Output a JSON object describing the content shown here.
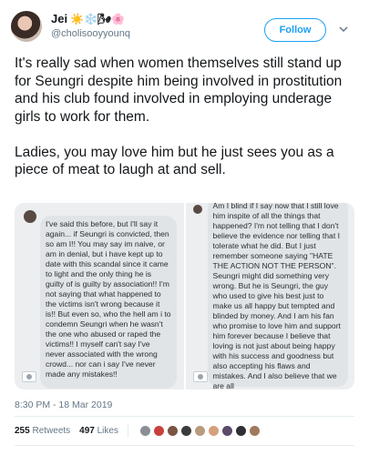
{
  "user": {
    "display_name": "Jei",
    "emoji": "☀️❄️🌬🌸",
    "handle": "@cholisooyyounq",
    "follow_label": "Follow"
  },
  "tweet": {
    "paragraphs": [
      "It's really sad when women themselves still stand up for Seungri despite him being involved in prostitution and his club found involved in employing underage girls to work for them.",
      "Ladies, you may love him but he just sees you as a piece of meat to laugh at and sell."
    ],
    "timestamp": "8:30 PM - 18 Mar 2019"
  },
  "media": {
    "left_text": "I've said this before, but I'll say it again... if Seungri is convicted, then so am I!! You may say im naive, or am in denial, but i have kept up to date with this scandal since it came to light and the only thing he is guilty of is guilty by association!! I'm not saying that what happened to the victims isn't wrong because it is!! But even so, who the hell am i to condemn Seungri when he wasn't the one who abused or raped the victims!! I myself can't say I've never associated with the wrong crowd... nor can i say I've never made any mistakes!!",
    "right_text": "Am I blind if I say now that I still love him inspite of all the things that happened? I'm not telling that I don't believe the evidence nor telling that I tolerate what he did. But I just remember someone saying \"HATE THE ACTION NOT THE PERSON\". Seungri might did something very wrong. But he is Seungri, the guy who used to give his best just to make us all happy but tempted and blinded by money. And I am his fan who promise to love him and support him forever because I believe that loving is not just about being happy with his success and goodness but also accepting his flaws and mistakes. And I also believe that we are all"
  },
  "stats": {
    "retweets_count": "255",
    "retweets_label": "Retweets",
    "likes_count": "497",
    "likes_label": "Likes"
  },
  "liker_colors": [
    "#8a8f96",
    "#c9413d",
    "#7a5544",
    "#3b3b3b",
    "#b89a7e",
    "#d6a07a",
    "#5b4a6a",
    "#2f2f35",
    "#a07a5c"
  ]
}
